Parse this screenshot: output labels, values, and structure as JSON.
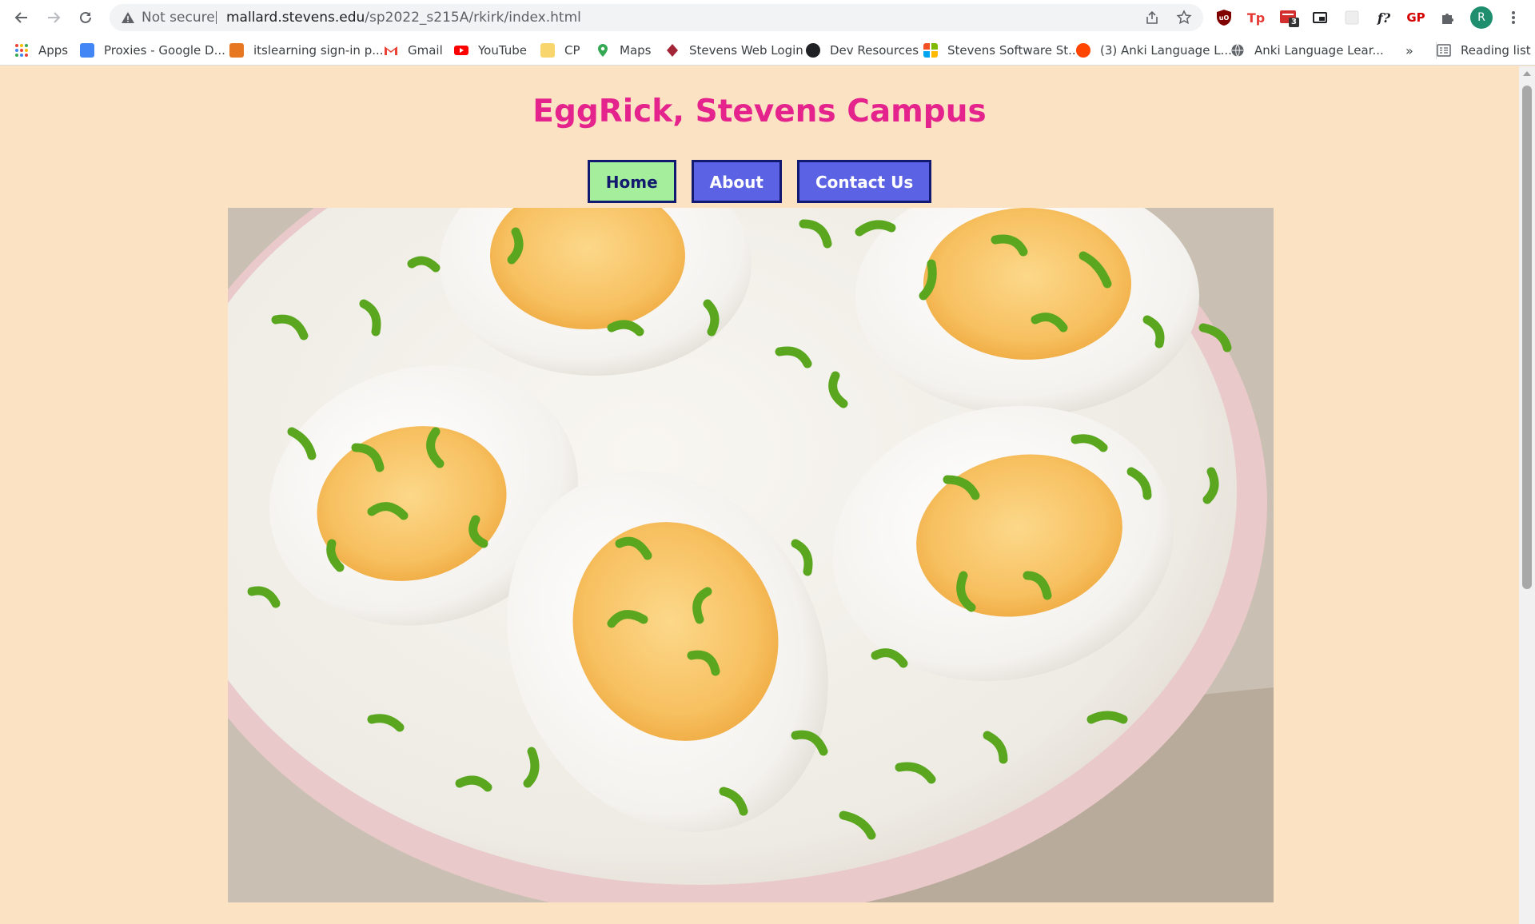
{
  "browser": {
    "omnibox": {
      "status": "Not secure",
      "url_host": "mallard.stevens.edu",
      "url_path": "/sp2022_s215A/rkirk/index.html"
    },
    "extensions": {
      "mail_badge": "3",
      "formula_label": "f?",
      "gp_label": "GP",
      "tp_label": "Tp",
      "profile_initial": "R"
    },
    "bookmarks": [
      {
        "label": "Apps",
        "icon": "apps-grid-icon"
      },
      {
        "label": "Proxies - Google D...",
        "icon": "google-docs-icon"
      },
      {
        "label": "itslearning sign-in p...",
        "icon": "itslearning-icon"
      },
      {
        "label": "Gmail",
        "icon": "gmail-icon"
      },
      {
        "label": "YouTube",
        "icon": "youtube-icon"
      },
      {
        "label": "CP",
        "icon": "folder-icon"
      },
      {
        "label": "Maps",
        "icon": "maps-pin-icon"
      },
      {
        "label": "Stevens Web Login",
        "icon": "stevens-icon"
      },
      {
        "label": "Dev Resources",
        "icon": "dr-icon"
      },
      {
        "label": "Stevens Software St...",
        "icon": "microsoft-icon"
      },
      {
        "label": "(3) Anki Language L...",
        "icon": "reddit-icon"
      },
      {
        "label": "Anki Language Lear...",
        "icon": "globe-icon"
      }
    ],
    "bookmarks_overflow": "»",
    "reading_list": "Reading list"
  },
  "page": {
    "title": "EggRick, Stevens Campus",
    "nav": [
      {
        "label": "Home",
        "active": true
      },
      {
        "label": "About",
        "active": false
      },
      {
        "label": "Contact Us",
        "active": false
      }
    ],
    "hero_alt": "Hard boiled eggs with green onions"
  },
  "colors": {
    "page_background": "#fbe2c2",
    "title": "#e4238c",
    "nav_button": "#5b63e4",
    "nav_active": "#a4ee9c",
    "nav_border": "#111970"
  }
}
